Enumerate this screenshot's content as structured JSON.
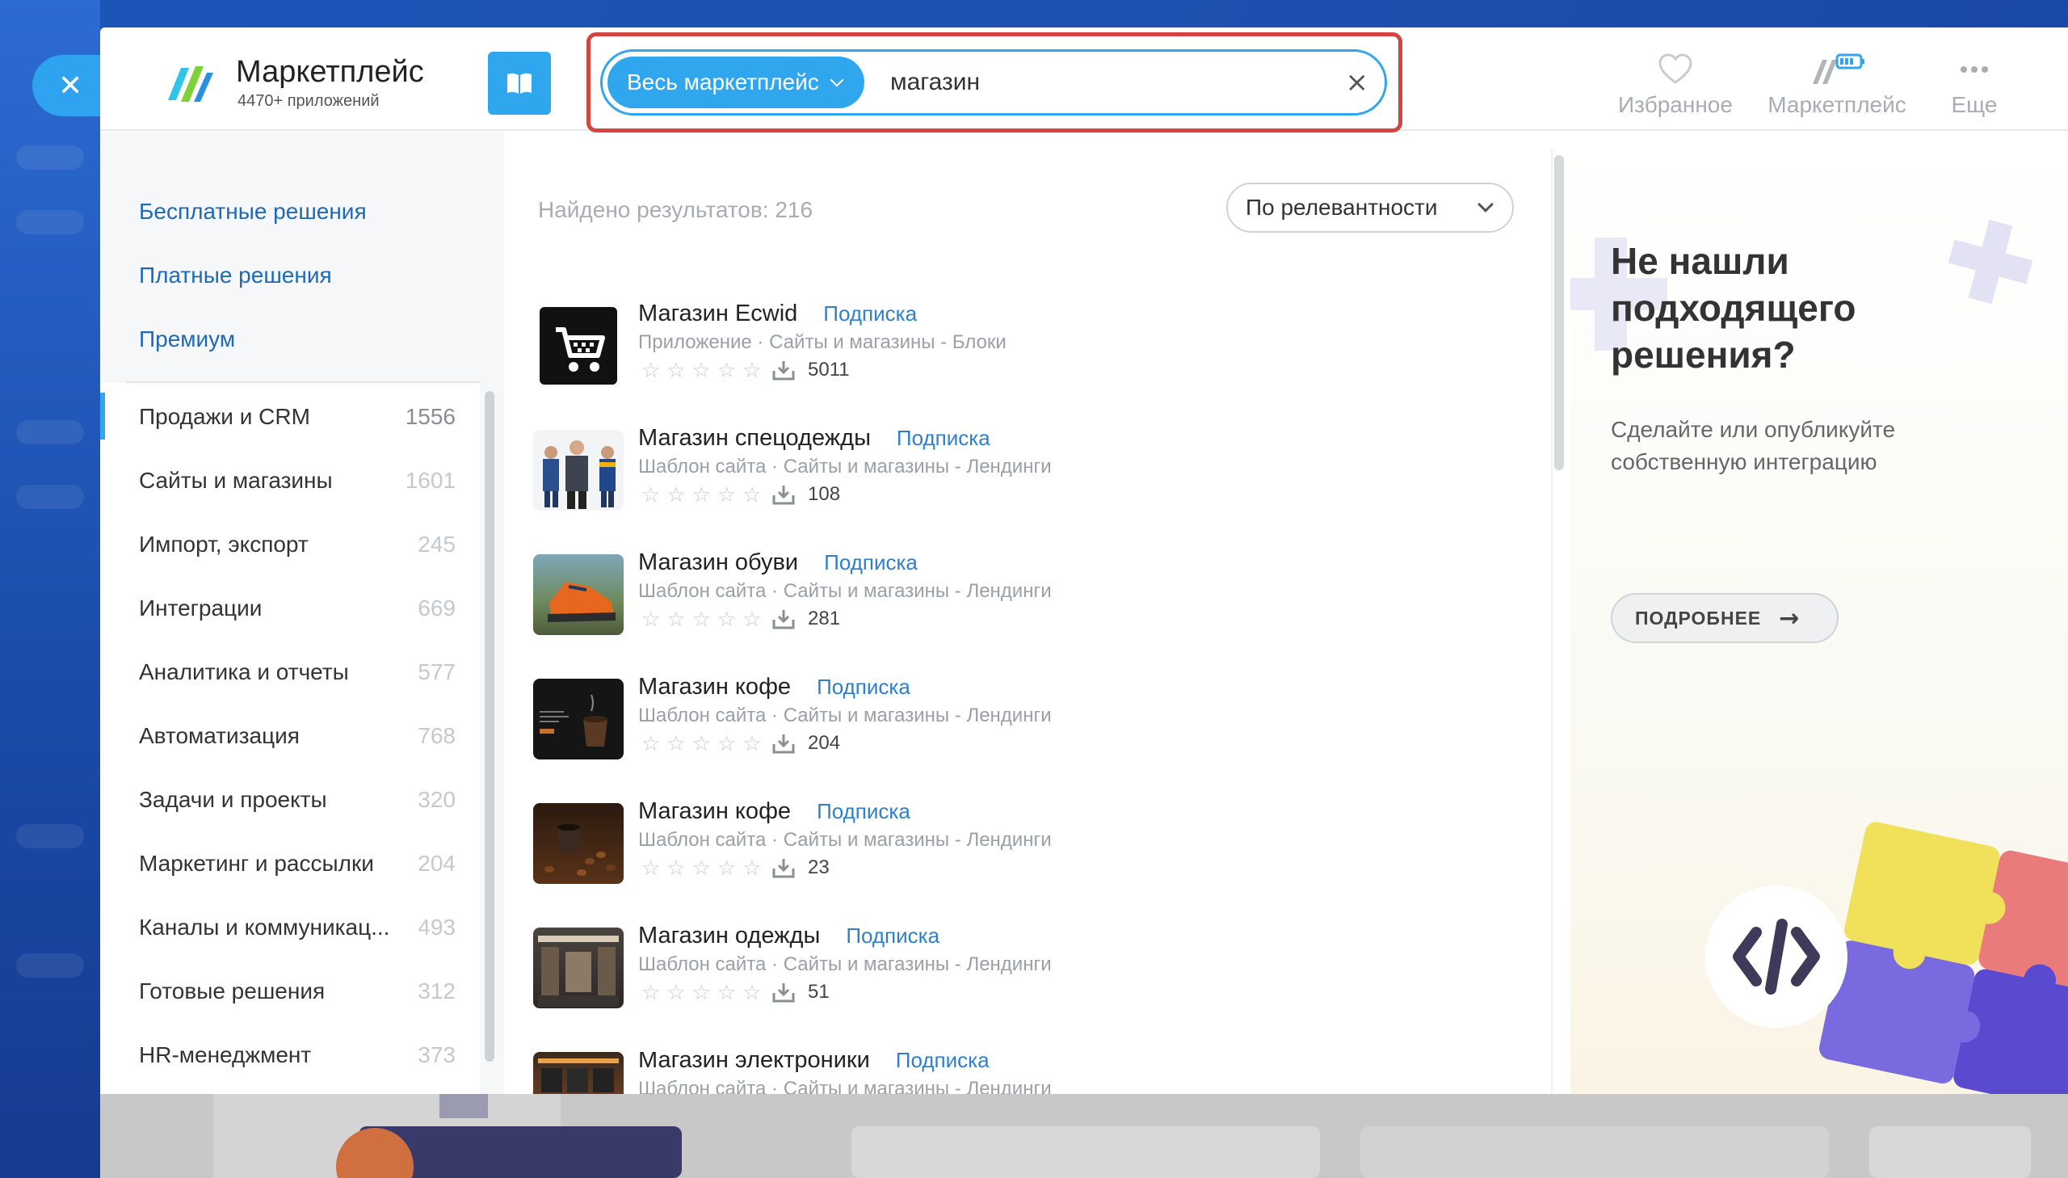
{
  "app": {
    "title": "Маркетплейс",
    "subtitle": "4470+ приложений"
  },
  "search": {
    "scope_label": "Весь маркетплейс",
    "query": "магазин",
    "clear_symbol": "×"
  },
  "header_nav": {
    "favorites": "Избранное",
    "marketplace": "Маркетплейс",
    "more": "Еще"
  },
  "sidebar": {
    "top_links": [
      "Бесплатные решения",
      "Платные решения",
      "Премиум"
    ],
    "categories": [
      {
        "label": "Продажи и CRM",
        "count": "1556"
      },
      {
        "label": "Сайты и магазины",
        "count": "1601"
      },
      {
        "label": "Импорт, экспорт",
        "count": "245"
      },
      {
        "label": "Интеграции",
        "count": "669"
      },
      {
        "label": "Аналитика и отчеты",
        "count": "577"
      },
      {
        "label": "Автоматизация",
        "count": "768"
      },
      {
        "label": "Задачи и проекты",
        "count": "320"
      },
      {
        "label": "Маркетинг и рассылки",
        "count": "204"
      },
      {
        "label": "Каналы и коммуникац...",
        "count": "493"
      },
      {
        "label": "Готовые решения",
        "count": "312"
      },
      {
        "label": "HR-менеджмент",
        "count": "373"
      }
    ]
  },
  "results": {
    "found_text": "Найдено результатов: 216",
    "sort_label": "По релевантности",
    "items": [
      {
        "name": "Магазин Ecwid",
        "badge": "Подписка",
        "meta": "Приложение · Сайты и магазины - Блоки",
        "downloads": "5011"
      },
      {
        "name": "Магазин спецодежды",
        "badge": "Подписка",
        "meta": "Шаблон сайта · Сайты и магазины - Лендинги",
        "downloads": "108"
      },
      {
        "name": "Магазин обуви",
        "badge": "Подписка",
        "meta": "Шаблон сайта · Сайты и магазины - Лендинги",
        "downloads": "281"
      },
      {
        "name": "Магазин кофе",
        "badge": "Подписка",
        "meta": "Шаблон сайта · Сайты и магазины - Лендинги",
        "downloads": "204"
      },
      {
        "name": "Магазин кофе",
        "badge": "Подписка",
        "meta": "Шаблон сайта · Сайты и магазины - Лендинги",
        "downloads": "23"
      },
      {
        "name": "Магазин одежды",
        "badge": "Подписка",
        "meta": "Шаблон сайта · Сайты и магазины - Лендинги",
        "downloads": "51"
      },
      {
        "name": "Магазин электроники",
        "badge": "Подписка",
        "meta": "Шаблон сайта · Сайты и магазины - Лендинги",
        "downloads": ""
      }
    ],
    "stars_text": "☆☆☆☆☆"
  },
  "promo": {
    "title": "Не нашли подходящего решения?",
    "text": "Сделайте или опубликуйте собственную интеграцию",
    "button": "ПОДРОБНЕЕ",
    "button_arrow": "→"
  },
  "colors": {
    "accent": "#2fa6ee",
    "highlight_frame": "#d4453f",
    "link": "#1f6ab8"
  }
}
